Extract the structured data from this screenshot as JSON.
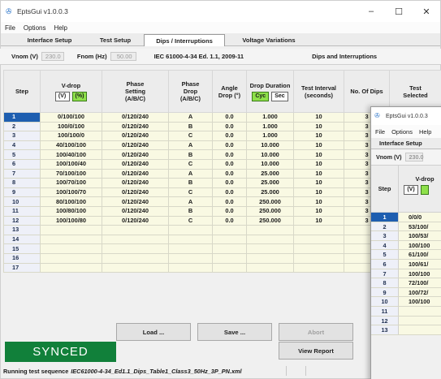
{
  "window": {
    "title": "EptsGui v1.0.0.3",
    "controls": {
      "minimize": "–",
      "maximize": "☐",
      "close": "✕"
    }
  },
  "menu": [
    "File",
    "Options",
    "Help"
  ],
  "tabs": [
    {
      "label": "Interface Setup",
      "active": false
    },
    {
      "label": "Test Setup",
      "active": false
    },
    {
      "label": "Dips / Interruptions",
      "active": true
    },
    {
      "label": "Voltage Variations",
      "active": false
    }
  ],
  "info": {
    "vnom_label": "Vnom (V)",
    "vnom_value": "230.0",
    "fnom_label": "Fnom (Hz)",
    "fnom_value": "50.00",
    "standard": "IEC 61000-4-34 Ed. 1.1, 2009-11",
    "section": "Dips and Interruptions"
  },
  "table": {
    "headers": {
      "step": "Step",
      "vdrop": "V-drop",
      "vdrop_btn_v": "(V)",
      "vdrop_btn_pct": "(%)",
      "phase_setting": [
        "Phase",
        "Setting",
        "(A/B/C)"
      ],
      "phase_drop": [
        "Phase",
        "Drop",
        "(A/B/C)"
      ],
      "angle_drop": [
        "Angle",
        "Drop (°)"
      ],
      "drop_duration": "Drop Duration",
      "dur_btn_cyc": "Cyc",
      "dur_btn_sec": "Sec",
      "test_interval": [
        "Test Interval",
        "(seconds)"
      ],
      "num_dips": "No. Of Dips",
      "test_selected": [
        "Test",
        "Selected"
      ]
    },
    "rows": [
      {
        "step": "1",
        "vdrop": "0/100/100",
        "phase": "0/120/240",
        "pdrop": "A",
        "angle": "0.0",
        "dur": "1.000",
        "interval": "10",
        "dips": "3"
      },
      {
        "step": "2",
        "vdrop": "100/0/100",
        "phase": "0/120/240",
        "pdrop": "B",
        "angle": "0.0",
        "dur": "1.000",
        "interval": "10",
        "dips": "3"
      },
      {
        "step": "3",
        "vdrop": "100/100/0",
        "phase": "0/120/240",
        "pdrop": "C",
        "angle": "0.0",
        "dur": "1.000",
        "interval": "10",
        "dips": "3"
      },
      {
        "step": "4",
        "vdrop": "40/100/100",
        "phase": "0/120/240",
        "pdrop": "A",
        "angle": "0.0",
        "dur": "10.000",
        "interval": "10",
        "dips": "3"
      },
      {
        "step": "5",
        "vdrop": "100/40/100",
        "phase": "0/120/240",
        "pdrop": "B",
        "angle": "0.0",
        "dur": "10.000",
        "interval": "10",
        "dips": "3"
      },
      {
        "step": "6",
        "vdrop": "100/100/40",
        "phase": "0/120/240",
        "pdrop": "C",
        "angle": "0.0",
        "dur": "10.000",
        "interval": "10",
        "dips": "3"
      },
      {
        "step": "7",
        "vdrop": "70/100/100",
        "phase": "0/120/240",
        "pdrop": "A",
        "angle": "0.0",
        "dur": "25.000",
        "interval": "10",
        "dips": "3"
      },
      {
        "step": "8",
        "vdrop": "100/70/100",
        "phase": "0/120/240",
        "pdrop": "B",
        "angle": "0.0",
        "dur": "25.000",
        "interval": "10",
        "dips": "3"
      },
      {
        "step": "9",
        "vdrop": "100/100/70",
        "phase": "0/120/240",
        "pdrop": "C",
        "angle": "0.0",
        "dur": "25.000",
        "interval": "10",
        "dips": "3"
      },
      {
        "step": "10",
        "vdrop": "80/100/100",
        "phase": "0/120/240",
        "pdrop": "A",
        "angle": "0.0",
        "dur": "250.000",
        "interval": "10",
        "dips": "3"
      },
      {
        "step": "11",
        "vdrop": "100/80/100",
        "phase": "0/120/240",
        "pdrop": "B",
        "angle": "0.0",
        "dur": "250.000",
        "interval": "10",
        "dips": "3"
      },
      {
        "step": "12",
        "vdrop": "100/100/80",
        "phase": "0/120/240",
        "pdrop": "C",
        "angle": "0.0",
        "dur": "250.000",
        "interval": "10",
        "dips": "3"
      },
      {
        "step": "13",
        "vdrop": "",
        "phase": "",
        "pdrop": "",
        "angle": "",
        "dur": "",
        "interval": "",
        "dips": ""
      },
      {
        "step": "14",
        "vdrop": "",
        "phase": "",
        "pdrop": "",
        "angle": "",
        "dur": "",
        "interval": "",
        "dips": ""
      },
      {
        "step": "15",
        "vdrop": "",
        "phase": "",
        "pdrop": "",
        "angle": "",
        "dur": "",
        "interval": "",
        "dips": ""
      },
      {
        "step": "16",
        "vdrop": "",
        "phase": "",
        "pdrop": "",
        "angle": "",
        "dur": "",
        "interval": "",
        "dips": ""
      },
      {
        "step": "17",
        "vdrop": "",
        "phase": "",
        "pdrop": "",
        "angle": "",
        "dur": "",
        "interval": "",
        "dips": ""
      }
    ]
  },
  "buttons": {
    "load": "Load ...",
    "save": "Save ...",
    "abort": "Abort",
    "view_report": "View Report"
  },
  "sync_status": "SYNCED",
  "status_bar": {
    "label": "Running test sequence",
    "file": "IEC61000-4-34_Ed1.1_Dips_Table1_Class3_50Hz_3P_PN.xml"
  },
  "second_window": {
    "title": "EptsGui v1.0.0.3",
    "menu": [
      "File",
      "Options",
      "Help"
    ],
    "tab": "Interface Setup",
    "vnom_label": "Vnom (V)",
    "vnom_value": "230.0",
    "step_header": "Step",
    "vdrop_header": "V-drop",
    "btn_v": "(V)",
    "rows": [
      {
        "step": "1",
        "v": "0/0/0"
      },
      {
        "step": "2",
        "v": "53/100/"
      },
      {
        "step": "3",
        "v": "100/53/"
      },
      {
        "step": "4",
        "v": "100/100"
      },
      {
        "step": "5",
        "v": "61/100/"
      },
      {
        "step": "6",
        "v": "100/61/"
      },
      {
        "step": "7",
        "v": "100/100"
      },
      {
        "step": "8",
        "v": "72/100/"
      },
      {
        "step": "9",
        "v": "100/72/"
      },
      {
        "step": "10",
        "v": "100/100"
      },
      {
        "step": "11",
        "v": ""
      },
      {
        "step": "12",
        "v": ""
      },
      {
        "step": "13",
        "v": ""
      }
    ]
  }
}
